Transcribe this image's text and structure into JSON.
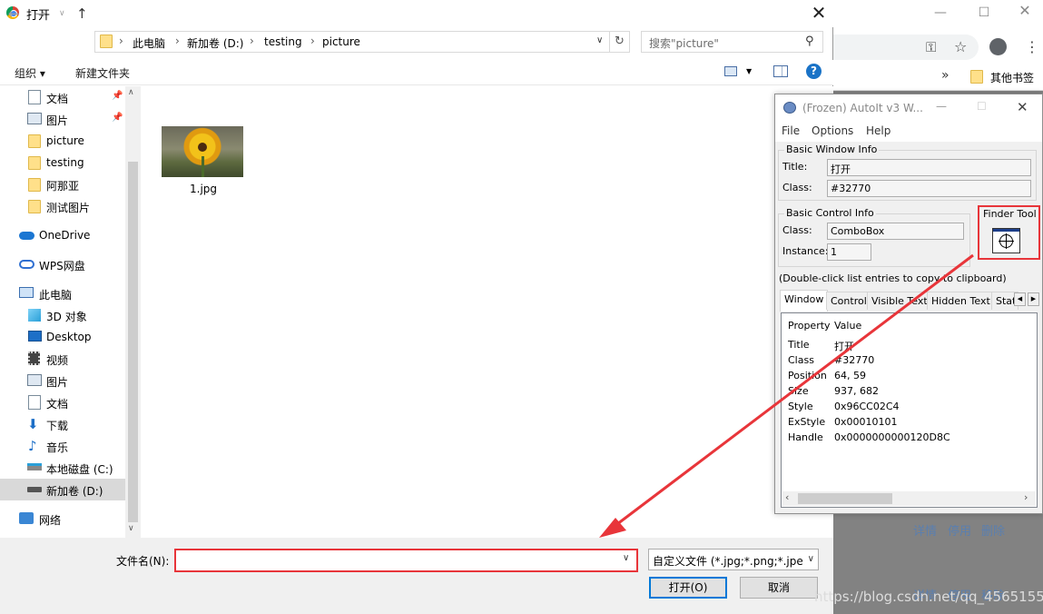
{
  "dialog": {
    "title": "打开",
    "breadcrumb": [
      "此电脑",
      "新加卷 (D:)",
      "testing",
      "picture"
    ],
    "search_placeholder": "搜索\"picture\"",
    "organize_label": "组织 ▾",
    "new_folder_label": "新建文件夹",
    "sidebar": {
      "items": [
        {
          "label": "文档",
          "icon": "document-icon",
          "pinned": true
        },
        {
          "label": "图片",
          "icon": "pictures-icon",
          "pinned": true
        },
        {
          "label": "picture",
          "icon": "folder-icon"
        },
        {
          "label": "testing",
          "icon": "folder-icon"
        },
        {
          "label": "阿那亚",
          "icon": "folder-icon"
        },
        {
          "label": "测试图片",
          "icon": "folder-icon"
        },
        {
          "label": "OneDrive",
          "icon": "cloud-icon"
        },
        {
          "label": "WPS网盘",
          "icon": "cloud-icon"
        },
        {
          "label": "此电脑",
          "icon": "computer-icon"
        },
        {
          "label": "3D 对象",
          "icon": "cube-icon"
        },
        {
          "label": "Desktop",
          "icon": "desktop-icon"
        },
        {
          "label": "视频",
          "icon": "video-icon"
        },
        {
          "label": "图片",
          "icon": "pictures-icon"
        },
        {
          "label": "文档",
          "icon": "document-icon"
        },
        {
          "label": "下载",
          "icon": "download-icon"
        },
        {
          "label": "音乐",
          "icon": "music-icon"
        },
        {
          "label": "本地磁盘 (C:)",
          "icon": "drive-icon"
        },
        {
          "label": "新加卷 (D:)",
          "icon": "drive-icon",
          "selected": true
        },
        {
          "label": "网络",
          "icon": "network-icon"
        }
      ]
    },
    "files": [
      {
        "name": "1.jpg",
        "icon": "sunflower-thumbnail"
      }
    ],
    "filename_label": "文件名(N):",
    "filename_value": "",
    "filter_value": "自定义文件 (*.jpg;*.png;*.jpeg",
    "open_button": "打开(O)",
    "cancel_button": "取消"
  },
  "chrome": {
    "bookmarks_more": "»",
    "bookmark_folder": "其他书签",
    "links": [
      "详情",
      "停用",
      "删除"
    ],
    "links2": [
      "详情",
      "停用",
      "移除"
    ]
  },
  "autoit": {
    "title": "(Frozen) AutoIt v3 W...",
    "menu": [
      "File",
      "Options",
      "Help"
    ],
    "basic_window_info": "Basic Window Info",
    "title_label": "Title:",
    "title_value": "打开",
    "class_label": "Class:",
    "class_value": "#32770",
    "basic_control_info": "Basic Control Info",
    "control_class_label": "Class:",
    "control_class_value": "ComboBox",
    "instance_label": "Instance:",
    "instance_value": "1",
    "finder_tool": "Finder Tool",
    "hint": "(Double-click list entries to copy to clipboard)",
    "tabs": [
      "Window",
      "Control",
      "Visible Text",
      "Hidden Text",
      "Stat"
    ],
    "list_header": {
      "property": "Property",
      "value": "Value"
    },
    "properties": [
      {
        "name": "Title",
        "value": "打开"
      },
      {
        "name": "Class",
        "value": "#32770"
      },
      {
        "name": "Position",
        "value": "64, 59"
      },
      {
        "name": "Size",
        "value": "937, 682"
      },
      {
        "name": "Style",
        "value": "0x96CC02C4"
      },
      {
        "name": "ExStyle",
        "value": "0x00010101"
      },
      {
        "name": "Handle",
        "value": "0x0000000000120D8C"
      }
    ]
  },
  "watermark": "https://blog.csdn.net/qq_45651552",
  "colors": {
    "annotation_red": "#e8353a",
    "accent_blue": "#0078d7"
  }
}
